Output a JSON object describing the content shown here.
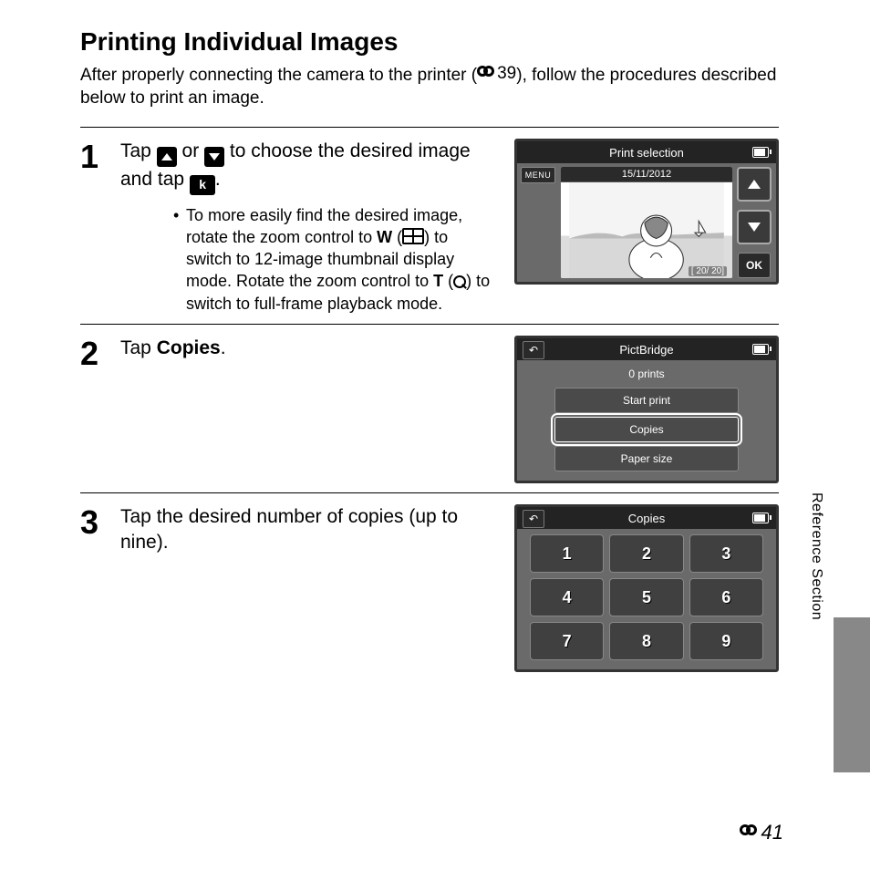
{
  "page": {
    "title": "Printing Individual Images",
    "intro_a": "After properly connecting the camera to the printer (",
    "intro_ref": "39",
    "intro_b": "), follow the procedures described below to print an image.",
    "side_label": "Reference Section",
    "page_number": "41"
  },
  "step1": {
    "num": "1",
    "line_a": "Tap ",
    "line_b": " or ",
    "line_c": " to choose the desired image and tap ",
    "line_d": ".",
    "ok_label_inline": "k",
    "bullet_a": "To more easily find the desired image, rotate the zoom control to ",
    "w": "W",
    "bullet_b": " (",
    "bullet_c": ") to switch to 12-image thumbnail display mode. Rotate the zoom control to ",
    "t": "T",
    "bullet_d": " (",
    "bullet_e": ") to switch to full-frame playback mode."
  },
  "step2": {
    "num": "2",
    "line_a": "Tap ",
    "copies_bold": "Copies",
    "line_b": "."
  },
  "step3": {
    "num": "3",
    "line": "Tap the desired number of copies (up to nine)."
  },
  "lcd1": {
    "title": "Print selection",
    "menu": "MENU",
    "date": "15/11/2012",
    "counter": "[   20/   20]",
    "ok": "OK"
  },
  "lcd2": {
    "title": "PictBridge",
    "prints": "0 prints",
    "items": {
      "start": "Start print",
      "copies": "Copies",
      "paper": "Paper size"
    }
  },
  "lcd3": {
    "title": "Copies",
    "keys": [
      "1",
      "2",
      "3",
      "4",
      "5",
      "6",
      "7",
      "8",
      "9"
    ]
  }
}
